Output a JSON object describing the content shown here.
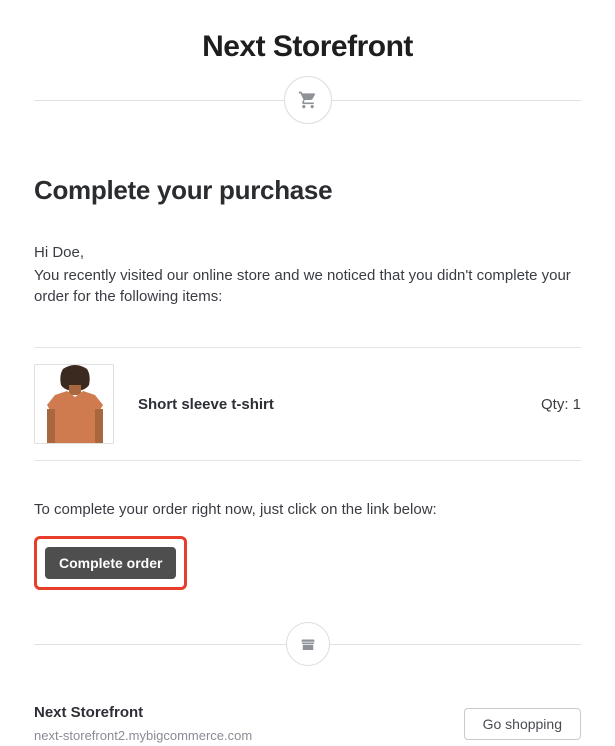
{
  "header": {
    "title": "Next Storefront"
  },
  "main": {
    "subheading": "Complete your purchase",
    "greeting": "Hi Doe,",
    "intro": "You recently visited our online store and we noticed that you didn't complete your order for the following items:",
    "item": {
      "name": "Short sleeve t-shirt",
      "qty_label": "Qty: 1"
    },
    "instruction": "To complete your order right now, just click on the link below:",
    "cta_label": "Complete order"
  },
  "footer": {
    "store_name": "Next Storefront",
    "domain": "next-storefront2.mybigcommerce.com",
    "go_shopping_label": "Go shopping"
  }
}
